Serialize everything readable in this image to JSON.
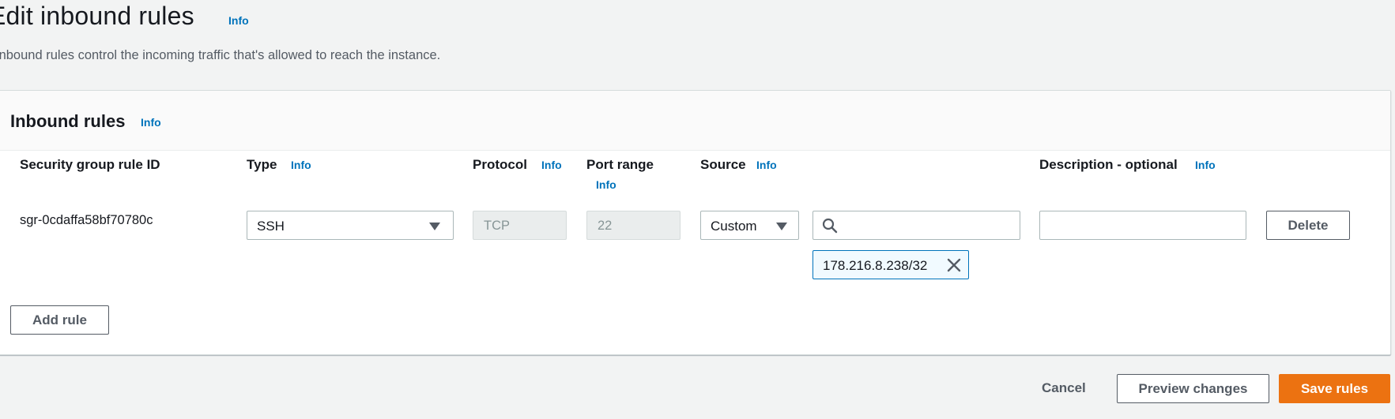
{
  "page": {
    "title": "Edit inbound rules",
    "title_info": "Info",
    "description": "Inbound rules control the incoming traffic that's allowed to reach the instance."
  },
  "panel": {
    "title": "Inbound rules",
    "info": "Info",
    "columns": {
      "rule_id": "Security group rule ID",
      "type": "Type",
      "type_info": "Info",
      "protocol": "Protocol",
      "protocol_info": "Info",
      "port_range": "Port range",
      "port_range_info": "Info",
      "source": "Source",
      "source_info": "Info",
      "description": "Description - optional",
      "description_info": "Info"
    },
    "rule": {
      "id": "sgr-0cdaffa58bf70780c",
      "type": "SSH",
      "protocol": "TCP",
      "port_range": "22",
      "source_type": "Custom",
      "source_search_value": "",
      "source_token": "178.216.8.238/32",
      "description_value": "",
      "delete_label": "Delete"
    },
    "add_rule_label": "Add rule"
  },
  "footer": {
    "cancel_label": "Cancel",
    "preview_label": "Preview changes",
    "save_label": "Save rules"
  },
  "colors": {
    "link": "#0073bb",
    "primary": "#ec7211",
    "background": "#f2f3f3"
  },
  "icons": [
    "caret-down-icon",
    "search-icon",
    "close-icon"
  ]
}
